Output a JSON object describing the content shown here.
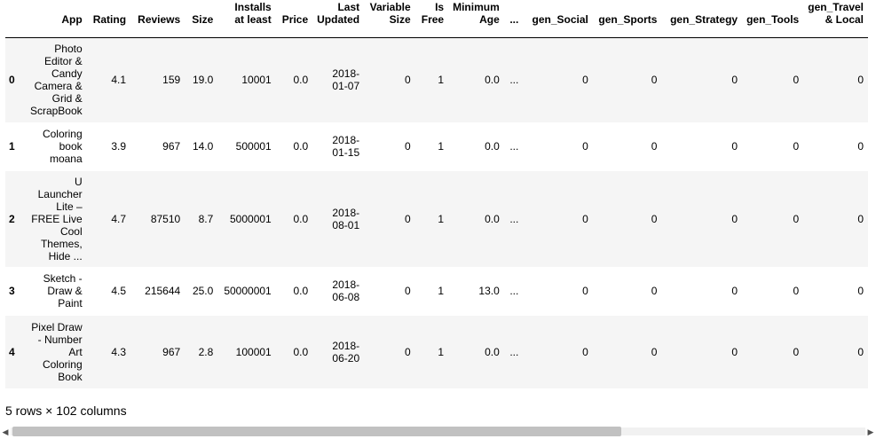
{
  "table": {
    "columns": [
      "",
      "App",
      "Rating",
      "Reviews",
      "Size",
      "Installs at least",
      "Price",
      "Last Updated",
      "Variable Size",
      "Is Free",
      "Minimum Age",
      "...",
      "gen_Social",
      "gen_Sports",
      "gen_Strategy",
      "gen_Tools",
      "gen_Travel & Local"
    ],
    "col_lines": [
      [
        ""
      ],
      [
        "App"
      ],
      [
        "Rating"
      ],
      [
        "Reviews"
      ],
      [
        "Size"
      ],
      [
        "Installs",
        "at least"
      ],
      [
        "Price"
      ],
      [
        "Last",
        "Updated"
      ],
      [
        "Variable",
        "Size"
      ],
      [
        "Is",
        "Free"
      ],
      [
        "Minimum",
        "Age"
      ],
      [
        "..."
      ],
      [
        "gen_Social"
      ],
      [
        "gen_Sports"
      ],
      [
        "gen_Strategy"
      ],
      [
        "gen_Tools"
      ],
      [
        "gen_Travel",
        "& Local"
      ]
    ],
    "rows": [
      {
        "index": "0",
        "app": [
          "Photo",
          "Editor &",
          "Candy",
          "Camera &",
          "Grid &",
          "ScrapBook"
        ],
        "rating": "4.1",
        "reviews": "159",
        "size": "19.0",
        "installs": "10001",
        "price": "0.0",
        "updated": [
          "2018-",
          "01-07"
        ],
        "variable_size": "0",
        "is_free": "1",
        "min_age": "0.0",
        "ellipsis": "...",
        "gen_social": "0",
        "gen_sports": "0",
        "gen_strategy": "0",
        "gen_tools": "0",
        "gen_travel": "0"
      },
      {
        "index": "1",
        "app": [
          "Coloring",
          "book",
          "moana"
        ],
        "rating": "3.9",
        "reviews": "967",
        "size": "14.0",
        "installs": "500001",
        "price": "0.0",
        "updated": [
          "2018-",
          "01-15"
        ],
        "variable_size": "0",
        "is_free": "1",
        "min_age": "0.0",
        "ellipsis": "...",
        "gen_social": "0",
        "gen_sports": "0",
        "gen_strategy": "0",
        "gen_tools": "0",
        "gen_travel": "0"
      },
      {
        "index": "2",
        "app": [
          "U",
          "Launcher",
          "Lite –",
          "FREE Live",
          "Cool",
          "Themes,",
          "Hide ..."
        ],
        "rating": "4.7",
        "reviews": "87510",
        "size": "8.7",
        "installs": "5000001",
        "price": "0.0",
        "updated": [
          "2018-",
          "08-01"
        ],
        "variable_size": "0",
        "is_free": "1",
        "min_age": "0.0",
        "ellipsis": "...",
        "gen_social": "0",
        "gen_sports": "0",
        "gen_strategy": "0",
        "gen_tools": "0",
        "gen_travel": "0"
      },
      {
        "index": "3",
        "app": [
          "Sketch -",
          "Draw &",
          "Paint"
        ],
        "rating": "4.5",
        "reviews": "215644",
        "size": "25.0",
        "installs": "50000001",
        "price": "0.0",
        "updated": [
          "2018-",
          "06-08"
        ],
        "variable_size": "0",
        "is_free": "1",
        "min_age": "13.0",
        "ellipsis": "...",
        "gen_social": "0",
        "gen_sports": "0",
        "gen_strategy": "0",
        "gen_tools": "0",
        "gen_travel": "0"
      },
      {
        "index": "4",
        "app": [
          "Pixel Draw",
          "- Number",
          "Art",
          "Coloring",
          "Book"
        ],
        "rating": "4.3",
        "reviews": "967",
        "size": "2.8",
        "installs": "100001",
        "price": "0.0",
        "updated": [
          "2018-",
          "06-20"
        ],
        "variable_size": "0",
        "is_free": "1",
        "min_age": "0.0",
        "ellipsis": "...",
        "gen_social": "0",
        "gen_sports": "0",
        "gen_strategy": "0",
        "gen_tools": "0",
        "gen_travel": "0"
      }
    ]
  },
  "footer": {
    "summary": "5 rows × 102 columns"
  },
  "scrollbar": {
    "left_arrow": "◀",
    "right_arrow": "▶"
  },
  "colors": {
    "row_odd": "#f5f5f5",
    "row_even": "#ffffff",
    "scroll_thumb": "#c1c1c1"
  }
}
